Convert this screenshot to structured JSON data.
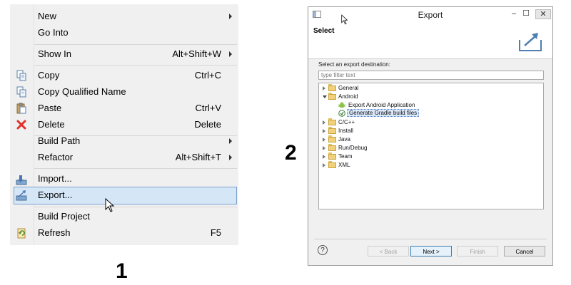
{
  "step_labels": {
    "one": "1",
    "two": "2"
  },
  "context_menu": {
    "items": [
      {
        "label": "New",
        "shortcut": "",
        "submenu": true
      },
      {
        "label": "Go Into",
        "shortcut": "",
        "submenu": false
      },
      {
        "label": "Show In",
        "shortcut": "Alt+Shift+W",
        "submenu": true
      },
      {
        "label": "Copy",
        "shortcut": "Ctrl+C",
        "submenu": false,
        "icon": "copy-icon"
      },
      {
        "label": "Copy Qualified Name",
        "shortcut": "",
        "submenu": false,
        "icon": "copy-qualified-name-icon"
      },
      {
        "label": "Paste",
        "shortcut": "Ctrl+V",
        "submenu": false,
        "icon": "paste-icon"
      },
      {
        "label": "Delete",
        "shortcut": "Delete",
        "submenu": false,
        "icon": "delete-icon",
        "icon_color": "#e2302b"
      },
      {
        "label": "Build Path",
        "shortcut": "",
        "submenu": true
      },
      {
        "label": "Refactor",
        "shortcut": "Alt+Shift+T",
        "submenu": true
      },
      {
        "label": "Import...",
        "shortcut": "",
        "submenu": false,
        "icon": "import-icon"
      },
      {
        "label": "Export...",
        "shortcut": "",
        "submenu": false,
        "icon": "export-icon",
        "highlighted": true
      },
      {
        "label": "Build Project",
        "shortcut": "",
        "submenu": false
      },
      {
        "label": "Refresh",
        "shortcut": "F5",
        "submenu": false,
        "icon": "refresh-icon"
      }
    ],
    "highlight_color": "#d5e6f7"
  },
  "export_dialog": {
    "title": "Export",
    "window_buttons": {
      "minimize": "–",
      "maximize": "☐",
      "close": "✕"
    },
    "banner_title": "Select",
    "prompt": "Select an export destination:",
    "filter_placeholder": "type filter text",
    "tree": [
      {
        "label": "General",
        "expanded": false
      },
      {
        "label": "Android",
        "expanded": true,
        "children": [
          {
            "label": "Export Android Application",
            "icon": "android-icon"
          },
          {
            "label": "Generate Gradle build files",
            "icon": "gradle-icon",
            "selected": true
          }
        ]
      },
      {
        "label": "C/C++",
        "expanded": false
      },
      {
        "label": "Install",
        "expanded": false
      },
      {
        "label": "Java",
        "expanded": false
      },
      {
        "label": "Run/Debug",
        "expanded": false
      },
      {
        "label": "Team",
        "expanded": false
      },
      {
        "label": "XML",
        "expanded": false
      }
    ],
    "buttons": {
      "help": "?",
      "back": "< Back",
      "next": "Next >",
      "finish": "Finish",
      "cancel": "Cancel"
    }
  }
}
